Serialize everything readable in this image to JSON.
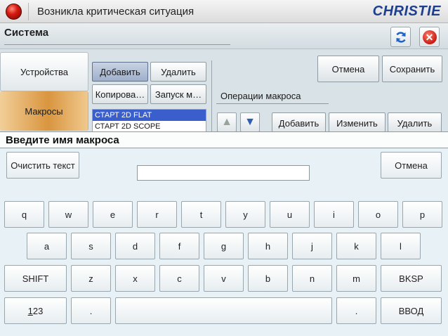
{
  "window": {
    "title": "Возникла критическая ситуация",
    "logo": "CHRISTIE"
  },
  "header": {
    "title": "Система"
  },
  "icons": {
    "refresh": "refresh-icon",
    "close": "close-icon"
  },
  "colors": {
    "alert_red": "#d61a10",
    "logo_blue": "#1e3f8f",
    "selection_blue": "#3a5fcd",
    "macros_tab_orange": "#d9953f"
  },
  "sidebar": {
    "tabs": [
      {
        "label": "Устройства",
        "active": false
      },
      {
        "label": "Макросы",
        "active": true
      }
    ]
  },
  "macros": {
    "add_label": "Добавить",
    "delete_label": "Удалить",
    "copy_label": "Копирова…",
    "run_label": "Запуск м…",
    "list": [
      "СТАРТ 2D FLAT",
      "СТАРТ 2D SCOPE"
    ],
    "selected": "СТАРТ 2D FLAT"
  },
  "operations": {
    "title": "Операции макроса",
    "add_label": "Добавить",
    "edit_label": "Изменить",
    "delete_label": "Удалить"
  },
  "actions": {
    "cancel_label": "Отмена",
    "save_label": "Сохранить"
  },
  "keyboard": {
    "title": "Введите имя макроса",
    "clear_label": "Очистить текст",
    "cancel_label": "Отмена",
    "input_value": "",
    "row1": [
      "q",
      "w",
      "e",
      "r",
      "t",
      "y",
      "u",
      "i",
      "o",
      "p"
    ],
    "row2": [
      "a",
      "s",
      "d",
      "f",
      "g",
      "h",
      "j",
      "k",
      "l"
    ],
    "row3": [
      "SHIFT",
      "z",
      "x",
      "c",
      "v",
      "b",
      "n",
      "m",
      "BKSP"
    ],
    "row4": {
      "num_first": "1",
      "num_rest": "23",
      "dot_left": ".",
      "space": "",
      "dot_right": ".",
      "enter": "ВВОД"
    }
  }
}
